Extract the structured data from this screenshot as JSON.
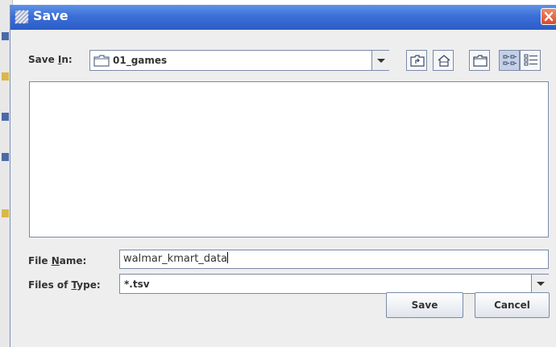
{
  "dialog": {
    "title": "Save",
    "save_in_label_pre": "Save ",
    "save_in_label_key": "I",
    "save_in_label_post": "n:",
    "save_in_value": "01_games",
    "file_name_label_pre": "File ",
    "file_name_label_key": "N",
    "file_name_label_post": "ame:",
    "file_name_value": "walmar_kmart_data",
    "file_type_label_pre": "Files of ",
    "file_type_label_key": "T",
    "file_type_label_post": "ype:",
    "file_type_value": "*.tsv",
    "save_button": "Save",
    "cancel_button": "Cancel"
  },
  "icons": {
    "title": "java-save-dialog-icon",
    "close": "close-icon",
    "folder": "folder-icon",
    "up": "up-one-level-icon",
    "home": "home-icon",
    "new_folder": "new-folder-icon",
    "list_view": "list-view-icon",
    "details_view": "details-view-icon",
    "dropdown": "chevron-down-icon"
  },
  "colors": {
    "titlebar": "#3b6fd6",
    "close": "#d94a2a",
    "panel": "#eeeeee",
    "border": "#7a8aa8"
  }
}
